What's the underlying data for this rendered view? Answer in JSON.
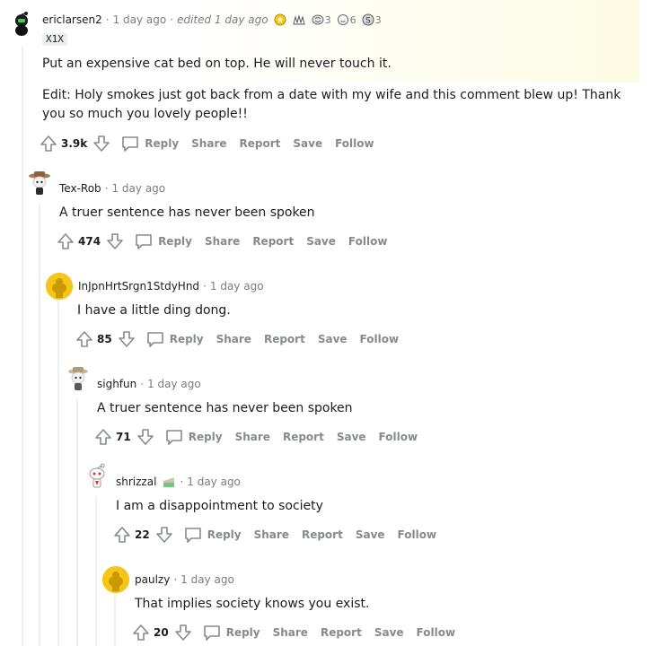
{
  "colors": {
    "highlight": "#fdfbe3",
    "thread_line": "#edeff1",
    "meta_gray": "#7c7c7c",
    "action_gray": "#878a8c"
  },
  "comments": [
    {
      "username": "ericlarsen2",
      "time": "1 day ago",
      "edited": "edited 1 day ago",
      "flair": "X1X",
      "awards": [
        {
          "icon": "gold-award-icon",
          "count": ""
        },
        {
          "icon": "hands-award-icon",
          "count": ""
        },
        {
          "icon": "brain-award-icon",
          "count": "3"
        },
        {
          "icon": "cheer-award-icon",
          "count": "6"
        },
        {
          "icon": "silver-award-icon",
          "count": "3"
        }
      ],
      "body": [
        "Put an expensive cat bed on top. He will never touch it.",
        "Edit: Holy smokes just got back from a date with my wife and this comment blew up! Thank you so much you lovely people!!"
      ],
      "score": "3.9k"
    },
    {
      "username": "Tex-Rob",
      "time": "1 day ago",
      "body": [
        "A truer sentence has never been spoken"
      ],
      "score": "474"
    },
    {
      "username": "InJpnHrtSrgn1StdyHnd",
      "time": "1 day ago",
      "body": [
        "I have a little ding dong."
      ],
      "score": "85"
    },
    {
      "username": "sighfun",
      "time": "1 day ago",
      "body": [
        "A truer sentence has never been spoken"
      ],
      "score": "71"
    },
    {
      "username": "shrizzal",
      "time": "1 day ago",
      "body": [
        "I am a disappointment to society"
      ],
      "score": "22"
    },
    {
      "username": "paulzy",
      "time": "1 day ago",
      "body": [
        "That implies society knows you exist."
      ],
      "score": "20"
    }
  ],
  "actions": {
    "reply": "Reply",
    "share": "Share",
    "report": "Report",
    "save": "Save",
    "follow": "Follow"
  }
}
